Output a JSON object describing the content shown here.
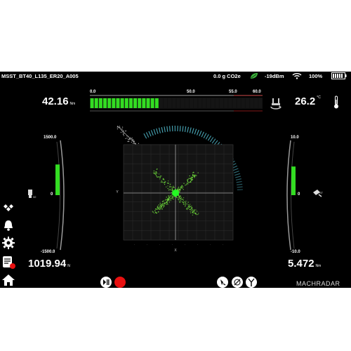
{
  "status_bar": {
    "title": "MSST_BT40_L135_ER20_A005",
    "co2_value": "0.0 g CO2e",
    "signal": "-19dBm",
    "battery": "100%"
  },
  "torque": {
    "value": "42.16",
    "unit": "Nm"
  },
  "temperature": {
    "value": "26.2",
    "unit": "°C"
  },
  "bar_scale": {
    "min": "0.0",
    "mid": "50.0",
    "warn": "55.0",
    "max": "60.0",
    "level_fraction": 0.41
  },
  "left_gauge": {
    "top": "1500.0",
    "zero": "0",
    "bottom": "-1500.0",
    "level_fraction": 0.13
  },
  "right_gauge": {
    "top": "10.0",
    "zero": "0",
    "bottom": "-10.0",
    "level_fraction": 0.17
  },
  "force": {
    "value": "1019.94",
    "unit": "N"
  },
  "bending": {
    "value": "5.472",
    "unit": "Nm"
  },
  "plot": {
    "xlabel": "X",
    "ylabel": "Y"
  },
  "brand": {
    "name": "MACHRADAR"
  },
  "icons": {
    "wifi": "wifi-icon",
    "battery": "battery-icon",
    "leaf": "leaf-icon",
    "thermometer": "thermometer-icon",
    "torque": "torque-icon",
    "bell": "bell-icon",
    "gear": "gear-icon",
    "report": "report-icon",
    "home": "home-icon",
    "diamond": "diamond-grid-icon",
    "play_pause": "play-pause-icon",
    "record": "record-icon"
  },
  "colors": {
    "accent_green": "#33dd22",
    "record_red": "#e81010",
    "arc_teal": "#4fb3c4"
  }
}
